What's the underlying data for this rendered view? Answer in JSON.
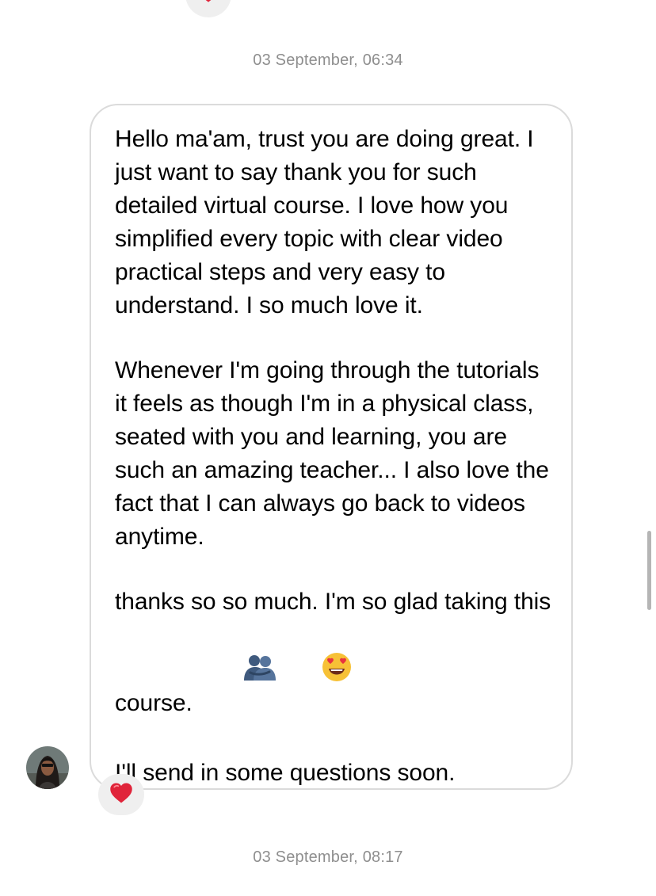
{
  "conversation": {
    "timestamps": [
      "03 September, 06:34",
      "03 September, 08:17"
    ],
    "message": {
      "paragraphs": [
        "Hello ma'am, trust you are doing great. I just want to say thank you for such detailed virtual course. I love how you simplified every topic with clear video practical steps and very easy to understand. I so much love it.",
        "Whenever I'm going through the tutorials it feels as though I'm in a physical class, seated with you and learning, you are such an amazing teacher... I also love the fact that I can always go back to videos anytime.",
        "thanks so so much. I'm so glad taking this course. ",
        "I'll send in some questions soon."
      ],
      "emojis": [
        "people-hugging-icon",
        "heart-eyes-icon"
      ],
      "reaction": "heart-icon"
    },
    "previous_reaction": "heart-icon",
    "sender_avatar": "avatar"
  },
  "colors": {
    "heart": "#e0243a",
    "bubble_border": "#dbdbdb",
    "timestamp": "#8e8e8e",
    "reaction_bg": "#efefef"
  }
}
